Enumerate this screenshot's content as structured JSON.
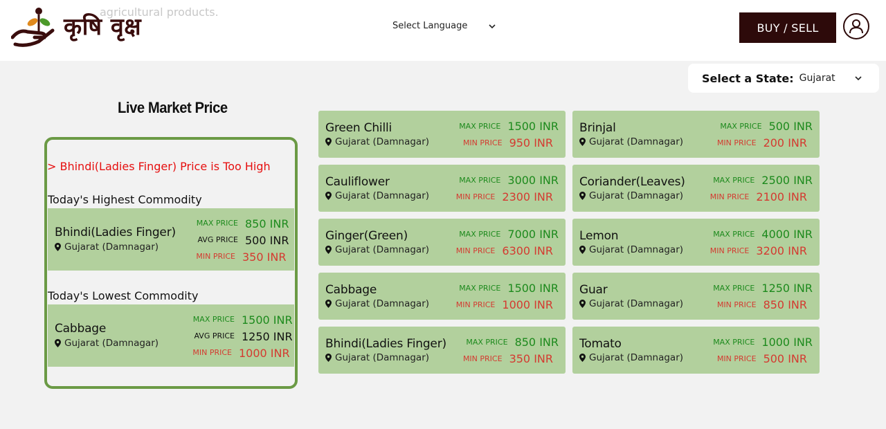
{
  "header": {
    "ghost_text": "agricultural products.",
    "brand_name": "कृषि वृक्ष",
    "language_select": "Select Language",
    "buy_sell_label": "BUY / SELL"
  },
  "state_selector": {
    "label": "Select a State:",
    "value": "Gujarat"
  },
  "left_panel": {
    "title": "Live Market Price",
    "alert": "> Bhindi(Ladies Finger) Price is Too High",
    "highest_label": "Today's Highest Commodity",
    "highest": {
      "name": "Bhindi(Ladies Finger)",
      "location": "Gujarat (Damnagar)",
      "max_label": "MAX PRICE",
      "max": "850 INR",
      "avg_label": "AVG PRICE",
      "avg": "500 INR",
      "min_label": "MIN PRICE",
      "min": "350 INR"
    },
    "lowest_label": "Today's Lowest Commodity",
    "lowest": {
      "name": "Cabbage",
      "location": "Gujarat (Damnagar)",
      "max_label": "MAX PRICE",
      "max": "1500 INR",
      "avg_label": "AVG PRICE",
      "avg": "1250 INR",
      "min_label": "MIN PRICE",
      "min": "1000 INR"
    }
  },
  "labels": {
    "max": "MAX PRICE",
    "min": "MIN PRICE"
  },
  "commodities": [
    {
      "name": "Green Chilli",
      "location": "Gujarat (Damnagar)",
      "max": "1500 INR",
      "min": "950 INR"
    },
    {
      "name": "Brinjal",
      "location": "Gujarat (Damnagar)",
      "max": "500 INR",
      "min": "200 INR"
    },
    {
      "name": "Cauliflower",
      "location": "Gujarat (Damnagar)",
      "max": "3000 INR",
      "min": "2300 INR"
    },
    {
      "name": "Coriander(Leaves)",
      "location": "Gujarat (Damnagar)",
      "max": "2500 INR",
      "min": "2100 INR"
    },
    {
      "name": "Ginger(Green)",
      "location": "Gujarat (Damnagar)",
      "max": "7000 INR",
      "min": "6300 INR"
    },
    {
      "name": "Lemon",
      "location": "Gujarat (Damnagar)",
      "max": "4000 INR",
      "min": "3200 INR"
    },
    {
      "name": "Cabbage",
      "location": "Gujarat (Damnagar)",
      "max": "1500 INR",
      "min": "1000 INR"
    },
    {
      "name": "Guar",
      "location": "Gujarat (Damnagar)",
      "max": "1250 INR",
      "min": "850 INR"
    },
    {
      "name": "Bhindi(Ladies Finger)",
      "location": "Gujarat (Damnagar)",
      "max": "850 INR",
      "min": "350 INR"
    },
    {
      "name": "Tomato",
      "location": "Gujarat (Damnagar)",
      "max": "1000 INR",
      "min": "500 INR"
    }
  ]
}
